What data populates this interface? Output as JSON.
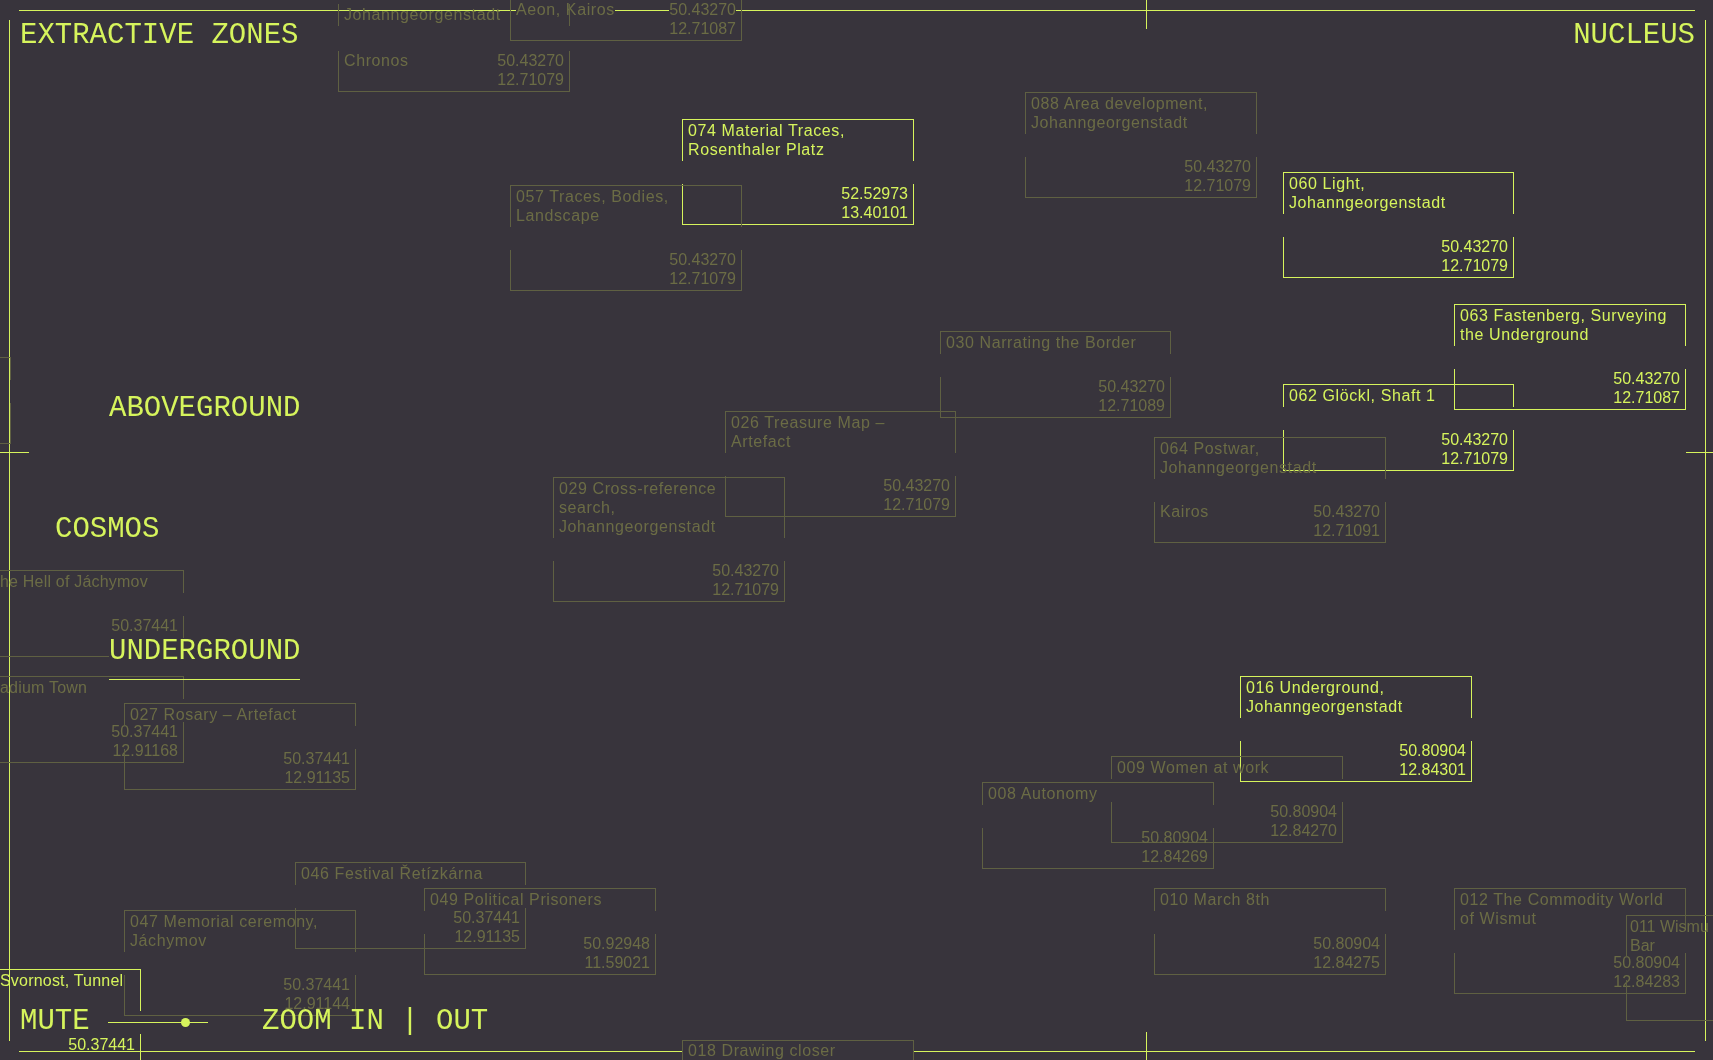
{
  "header": {
    "title": "EXTRACTIVE ZONES",
    "link": "NUCLEUS"
  },
  "layers": [
    {
      "label": "ABOVEGROUND",
      "selected": false
    },
    {
      "label": "COSMOS",
      "selected": false
    },
    {
      "label": "UNDERGROUND",
      "selected": true
    }
  ],
  "nodes": [
    {
      "tags": "Aeon, Kairos",
      "latitude": "50.43270",
      "longitude": "12.71087",
      "highlighted": false
    },
    {
      "title": "Johanngeorgenstadt",
      "tags": "Chronos",
      "latitude": "50.43270",
      "longitude": "12.71079",
      "highlighted": false
    },
    {
      "title": "088 Area development, Johanngeorgenstadt",
      "latitude": "50.43270",
      "longitude": "12.71079",
      "highlighted": false
    },
    {
      "title": "074 Material Traces, Rosenthaler Platz",
      "latitude": "52.52973",
      "longitude": "13.40101",
      "highlighted": true
    },
    {
      "title": "060 Light, Johanngeorgenstadt",
      "latitude": "50.43270",
      "longitude": "12.71079",
      "highlighted": true
    },
    {
      "title": "057 Traces, Bodies, Landscape",
      "latitude": "50.43270",
      "longitude": "12.71079",
      "highlighted": false
    },
    {
      "title": "063 Fastenberg, Surveying the Underground",
      "latitude": "50.43270",
      "longitude": "12.71087",
      "highlighted": true
    },
    {
      "title": "030 Narrating the Border",
      "latitude": "50.43270",
      "longitude": "12.71089",
      "highlighted": false
    },
    {
      "highlighted": false
    },
    {
      "title": "062 Glöckl, Shaft 1",
      "latitude": "50.43270",
      "longitude": "12.71079",
      "highlighted": true
    },
    {
      "title": "026 Treasure Map – Artefact",
      "latitude": "50.43270",
      "longitude": "12.71079",
      "highlighted": false
    },
    {
      "title": "064 Postwar, Johanngeorgenstadt",
      "tags": "Kairos",
      "latitude": "50.43270",
      "longitude": "12.71091",
      "highlighted": false
    },
    {
      "title": "029 Cross-reference search, Johanngeorgenstadt",
      "latitude": "50.43270",
      "longitude": "12.71079",
      "highlighted": false
    },
    {
      "title": "he Hell of Jáchymov",
      "latitude": "50.37441",
      "highlighted": false
    },
    {
      "title": "adium Town",
      "latitude": "50.37441",
      "longitude": "12.91168",
      "highlighted": false
    },
    {
      "title": "016 Underground, Johanngeorgenstadt",
      "latitude": "50.80904",
      "longitude": "12.84301",
      "highlighted": true
    },
    {
      "title": "027 Rosary – Artefact",
      "latitude": "50.37441",
      "longitude": "12.91135",
      "highlighted": false
    },
    {
      "title": "009 Women at work",
      "latitude": "50.80904",
      "longitude": "12.84270",
      "highlighted": false
    },
    {
      "title": "008 Autonomy",
      "latitude": "50.80904",
      "longitude": "12.84269",
      "highlighted": false
    },
    {
      "title": "046 Festival Řetízkárna",
      "latitude": "50.37441",
      "longitude": "12.91135",
      "highlighted": false
    },
    {
      "title": "049 Political Prisoners",
      "latitude": "50.92948",
      "longitude": "11.59021",
      "highlighted": false
    },
    {
      "title": "010 March 8th",
      "latitude": "50.80904",
      "longitude": "12.84275",
      "highlighted": false
    },
    {
      "title": "012 The Commodity World of Wismut",
      "latitude": "50.80904",
      "longitude": "12.84283",
      "highlighted": false
    },
    {
      "title": "047 Memorial ceremony, Jáchymov",
      "latitude": "50.37441",
      "longitude": "12.91144",
      "highlighted": false
    },
    {
      "title": "011 Wismu Bar",
      "highlighted": false
    },
    {
      "title": "Svornost, Tunnel",
      "latitude": "50.37441",
      "highlighted": true
    },
    {
      "title": "018 Drawing closer",
      "highlighted": false
    }
  ],
  "controls": {
    "mute": "MUTE",
    "volume": {
      "level": 0.77
    },
    "zoom_in": "ZOOM IN",
    "separator": "|",
    "zoom_out": "OUT"
  }
}
